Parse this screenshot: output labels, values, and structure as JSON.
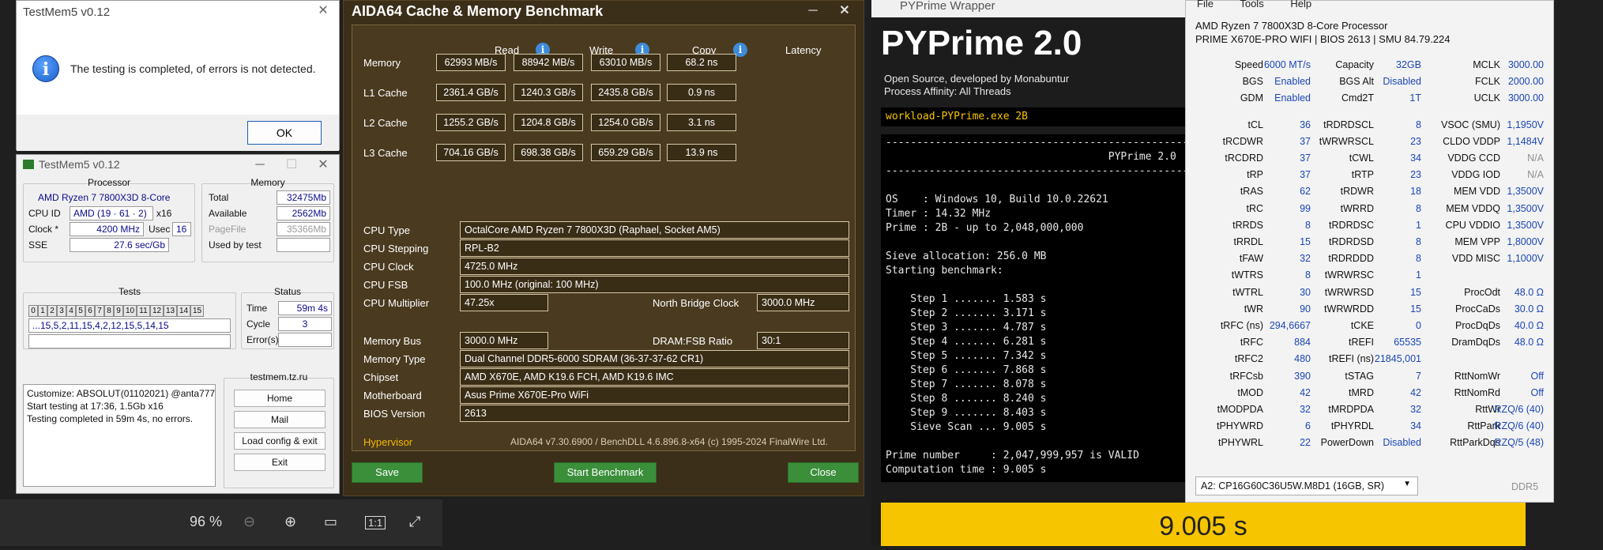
{
  "dialog": {
    "title": "TestMem5 v0.12",
    "message": "The testing is completed, of errors is not detected.",
    "ok_label": "OK"
  },
  "testmem": {
    "title": "TestMem5 v0.12",
    "processor_group": "Processor",
    "cpu_name": "AMD Ryzen 7 7800X3D 8-Core",
    "cpu_id_label": "CPU ID",
    "cpu_id_value": "AMD (19 · 61 · 2)",
    "cpu_id_x": "x16",
    "clock_label": "Clock *",
    "clock_value": "4200 MHz",
    "usec_label": "Usec",
    "usec_value": "16",
    "sse_label": "SSE",
    "sse_value": "27.6 sec/Gb",
    "memory_group": "Memory",
    "total_label": "Total",
    "total_value": "32475Mb",
    "available_label": "Available",
    "available_value": "2562Mb",
    "pagefile_label": "PageFile",
    "pagefile_value": "35366Mb",
    "usedby_label": "Used by test",
    "tests_group": "Tests",
    "test_cells": [
      "0",
      "1",
      "2",
      "3",
      "4",
      "5",
      "6",
      "7",
      "8",
      "9",
      "10",
      "11",
      "12",
      "13",
      "14",
      "15"
    ],
    "test_sequence": "...15,5,2,11,15,4,2,12,15,5,14,15",
    "status_group": "Status",
    "time_label": "Time",
    "time_value": "59m 4s",
    "cycle_label": "Cycle",
    "cycle_value": "3",
    "errors_label": "Error(s)",
    "log_lines": [
      "Customize: ABSOLUT(01102021) @anta777",
      "Start testing at 17:36, 1.5Gb x16",
      "Testing completed in 59m 4s, no errors."
    ],
    "site": "testmem.tz.ru",
    "buttons": [
      "Home",
      "Mail",
      "Load config & exit",
      "Exit"
    ]
  },
  "aida": {
    "title": "AIDA64 Cache & Memory Benchmark",
    "col_read": "Read",
    "col_write": "Write",
    "col_copy": "Copy",
    "col_latency": "Latency",
    "rows": [
      {
        "label": "Memory",
        "read": "62993 MB/s",
        "write": "88942 MB/s",
        "copy": "63010 MB/s",
        "latency": "68.2 ns"
      },
      {
        "label": "L1 Cache",
        "read": "2361.4 GB/s",
        "write": "1240.3 GB/s",
        "copy": "2435.8 GB/s",
        "latency": "0.9 ns"
      },
      {
        "label": "L2 Cache",
        "read": "1255.2 GB/s",
        "write": "1204.8 GB/s",
        "copy": "1254.0 GB/s",
        "latency": "3.1 ns"
      },
      {
        "label": "L3 Cache",
        "read": "704.16 GB/s",
        "write": "698.38 GB/s",
        "copy": "659.29 GB/s",
        "latency": "13.9 ns"
      }
    ],
    "cpu_type_label": "CPU Type",
    "cpu_type": "OctalCore AMD Ryzen 7 7800X3D  (Raphael, Socket AM5)",
    "cpu_stepping_label": "CPU Stepping",
    "cpu_stepping": "RPL-B2",
    "cpu_clock_label": "CPU Clock",
    "cpu_clock": "4725.0 MHz",
    "cpu_fsb_label": "CPU FSB",
    "cpu_fsb": "100.0 MHz  (original: 100 MHz)",
    "cpu_mult_label": "CPU Multiplier",
    "cpu_mult": "47.25x",
    "nb_clock_label": "North Bridge Clock",
    "nb_clock": "3000.0 MHz",
    "mem_bus_label": "Memory Bus",
    "mem_bus": "3000.0 MHz",
    "dram_fsb_label": "DRAM:FSB Ratio",
    "dram_fsb": "30:1",
    "mem_type_label": "Memory Type",
    "mem_type": "Dual Channel DDR5-6000 SDRAM  (36-37-37-62 CR1)",
    "chipset_label": "Chipset",
    "chipset": "AMD X670E, AMD K19.6 FCH, AMD K19.6 IMC",
    "motherboard_label": "Motherboard",
    "motherboard": "Asus Prime X670E-Pro WiFi",
    "bios_label": "BIOS Version",
    "bios": "2613",
    "hypervisor": "Hypervisor",
    "footer": "AIDA64 v7.30.6900 / BenchDLL 4.6.896.8-x64  (c) 1995-2024 FinalWire Ltd.",
    "save_label": "Save",
    "start_label": "Start Benchmark",
    "close_label": "Close"
  },
  "viewer": {
    "zoom": "96 %",
    "actual_size": "1:1"
  },
  "pyprime": {
    "window_title": "PYPrime Wrapper",
    "title": "PYPrime 2.0",
    "sub1": "Open Source, developed by Monabuntur",
    "sub2": "Process Affinity: All Threads",
    "workload": "workload-PYPrime.exe 2B",
    "console": [
      "-------------------------------------------------",
      "                                    PYPrime 2.0",
      "-------------------------------------------------",
      "",
      "OS    : Windows 10, Build 10.0.22621",
      "Timer : 14.32 MHz",
      "Prime : 2B - up to 2,048,000,000",
      "",
      "Sieve allocation: 256.0 MB",
      "Starting benchmark:",
      "",
      "    Step 1 ....... 1.583 s",
      "    Step 2 ....... 3.171 s",
      "    Step 3 ....... 4.787 s",
      "    Step 4 ....... 6.281 s",
      "    Step 5 ....... 7.342 s",
      "    Step 6 ....... 7.868 s",
      "    Step 7 ....... 8.078 s",
      "    Step 8 ....... 8.240 s",
      "    Step 9 ....... 8.403 s",
      "    Sieve Scan ... 9.005 s",
      "",
      "Prime number     : 2,047,999,957 is VALID",
      "Computation time : 9.005 s"
    ],
    "result": "9.005 s"
  },
  "zen": {
    "menu": [
      "File",
      "Tools",
      "Help"
    ],
    "cpu": "AMD Ryzen 7 7800X3D 8-Core Processor",
    "board": "PRIME X670E-PRO WIFI | BIOS 2613 | SMU 84.79.224",
    "rows": [
      [
        "Speed",
        "6000 MT/s",
        "Capacity",
        "32GB",
        "MCLK",
        "3000.00"
      ],
      [
        "BGS",
        "Enabled",
        "BGS Alt",
        "Disabled",
        "FCLK",
        "2000.00"
      ],
      [
        "GDM",
        "Enabled",
        "Cmd2T",
        "1T",
        "UCLK",
        "3000.00"
      ],
      [
        "",
        "",
        "",
        "",
        "",
        ""
      ],
      [
        "tCL",
        "36",
        "tRDRDSCL",
        "8",
        "VSOC (SMU)",
        "1,1950V"
      ],
      [
        "tRCDWR",
        "37",
        "tWRWRSCL",
        "23",
        "CLDO VDDP",
        "1,1484V"
      ],
      [
        "tRCDRD",
        "37",
        "tCWL",
        "34",
        "VDDG CCD",
        "N/A"
      ],
      [
        "tRP",
        "37",
        "tRTP",
        "23",
        "VDDG IOD",
        "N/A"
      ],
      [
        "tRAS",
        "62",
        "tRDWR",
        "18",
        "MEM VDD",
        "1,3500V"
      ],
      [
        "tRC",
        "99",
        "tWRRD",
        "8",
        "MEM VDDQ",
        "1,3500V"
      ],
      [
        "tRRDS",
        "8",
        "tRDRDSC",
        "1",
        "CPU VDDIO",
        "1,3500V"
      ],
      [
        "tRRDL",
        "15",
        "tRDRDSD",
        "8",
        "MEM VPP",
        "1,8000V"
      ],
      [
        "tFAW",
        "32",
        "tRDRDDD",
        "8",
        "VDD MISC",
        "1,1000V"
      ],
      [
        "tWTRS",
        "8",
        "tWRWRSC",
        "1",
        "",
        ""
      ],
      [
        "tWTRL",
        "30",
        "tWRWRSD",
        "15",
        "ProcOdt",
        "48.0 Ω"
      ],
      [
        "tWR",
        "90",
        "tWRWRDD",
        "15",
        "ProcCaDs",
        "30.0 Ω"
      ],
      [
        "tRFC (ns)",
        "294,6667",
        "tCKE",
        "0",
        "ProcDqDs",
        "40.0 Ω"
      ],
      [
        "tRFC",
        "884",
        "tREFI",
        "65535",
        "DramDqDs",
        "48.0 Ω"
      ],
      [
        "tRFC2",
        "480",
        "tREFI (ns)",
        "21845,001",
        "",
        ""
      ],
      [
        "tRFCsb",
        "390",
        "tSTAG",
        "7",
        "RttNomWr",
        "Off"
      ],
      [
        "tMOD",
        "42",
        "tMRD",
        "42",
        "RttNomRd",
        "Off"
      ],
      [
        "tMODPDA",
        "32",
        "tMRDPDA",
        "32",
        "RttWr",
        "RZQ/6 (40)"
      ],
      [
        "tPHYWRD",
        "6",
        "tPHYRDL",
        "34",
        "RttPark",
        "RZQ/6 (40)"
      ],
      [
        "tPHYWRL",
        "22",
        "PowerDown",
        "Disabled",
        "RttParkDqs",
        "RZQ/5 (48)"
      ]
    ],
    "dimm": "A2: CP16G60C36U5W.M8D1 (16GB, SR)",
    "ddr": "DDR5"
  }
}
